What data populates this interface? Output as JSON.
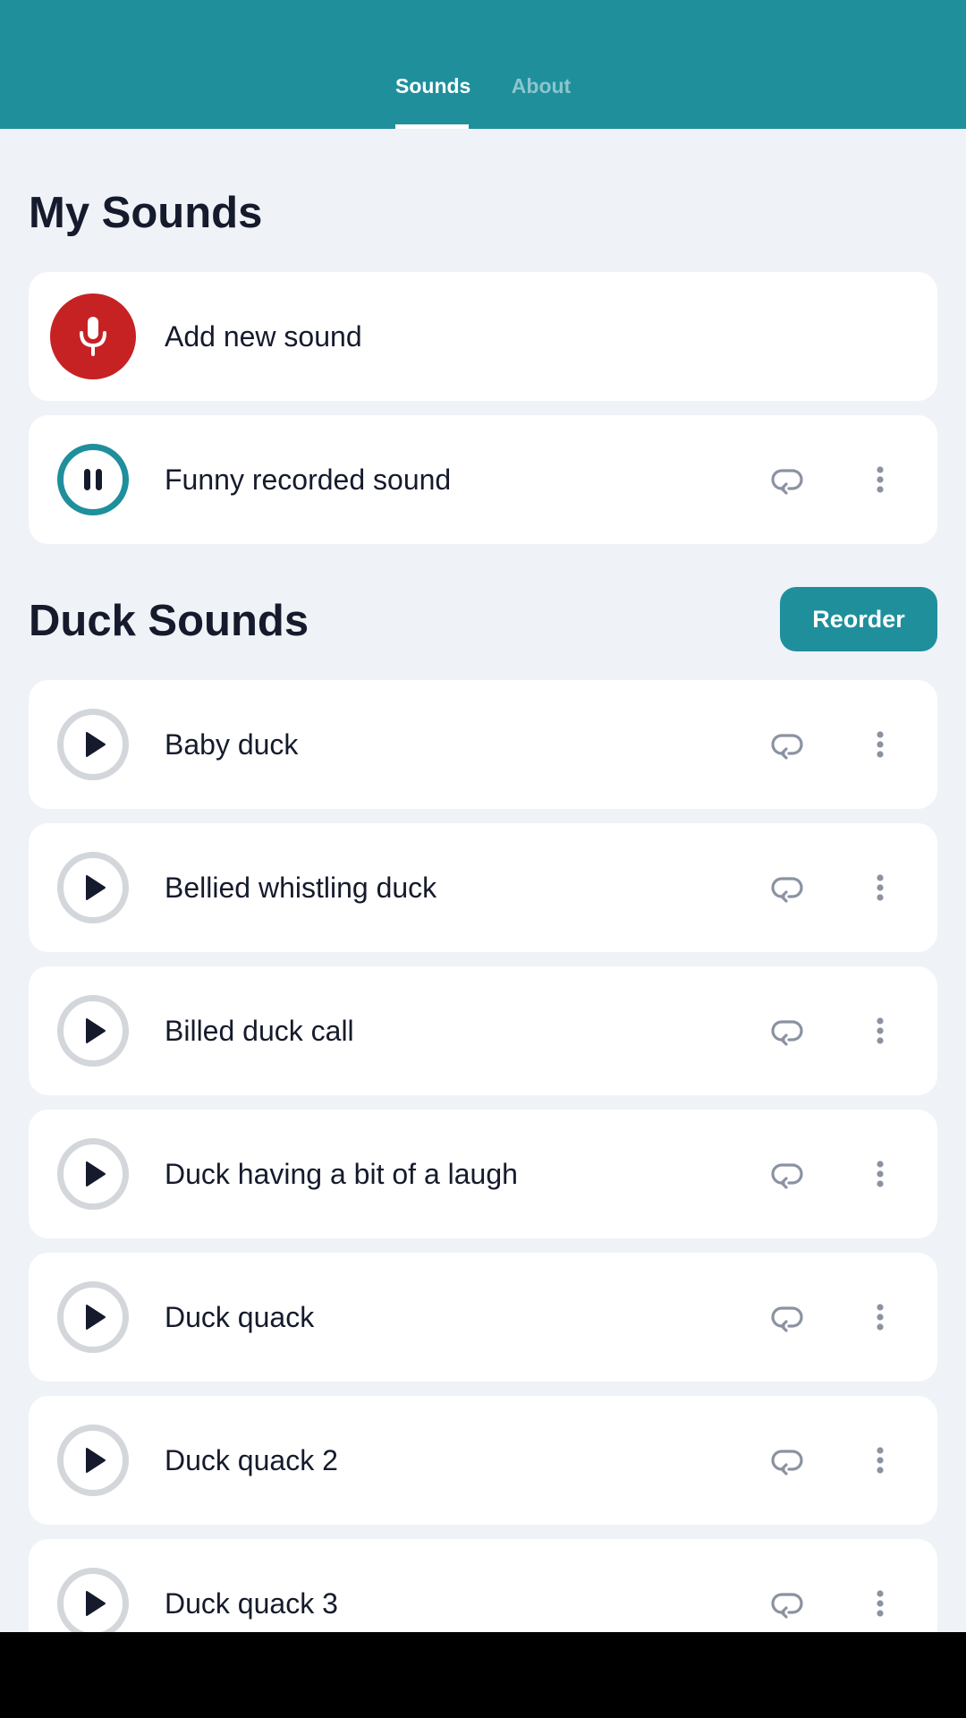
{
  "tabs": [
    {
      "label": "Sounds",
      "active": true
    },
    {
      "label": "About",
      "active": false
    }
  ],
  "colors": {
    "accent": "#1f8f9c",
    "record": "#c62224",
    "background": "#eff2f7",
    "text": "#151b2c",
    "muted_icon": "#8b93a1"
  },
  "my_sounds": {
    "title": "My Sounds",
    "add_label": "Add new sound",
    "items": [
      {
        "label": "Funny recorded sound",
        "state": "playing"
      }
    ]
  },
  "duck_sounds": {
    "title": "Duck Sounds",
    "reorder_label": "Reorder",
    "items": [
      {
        "label": "Baby duck"
      },
      {
        "label": "Bellied whistling duck"
      },
      {
        "label": "Billed duck call"
      },
      {
        "label": "Duck having a bit of a laugh"
      },
      {
        "label": "Duck quack"
      },
      {
        "label": "Duck quack 2"
      },
      {
        "label": "Duck quack 3"
      }
    ]
  },
  "icons": {
    "record": "microphone-icon",
    "pause": "pause-icon",
    "play": "play-icon",
    "loop": "loop-icon",
    "more": "more-vertical-icon"
  }
}
